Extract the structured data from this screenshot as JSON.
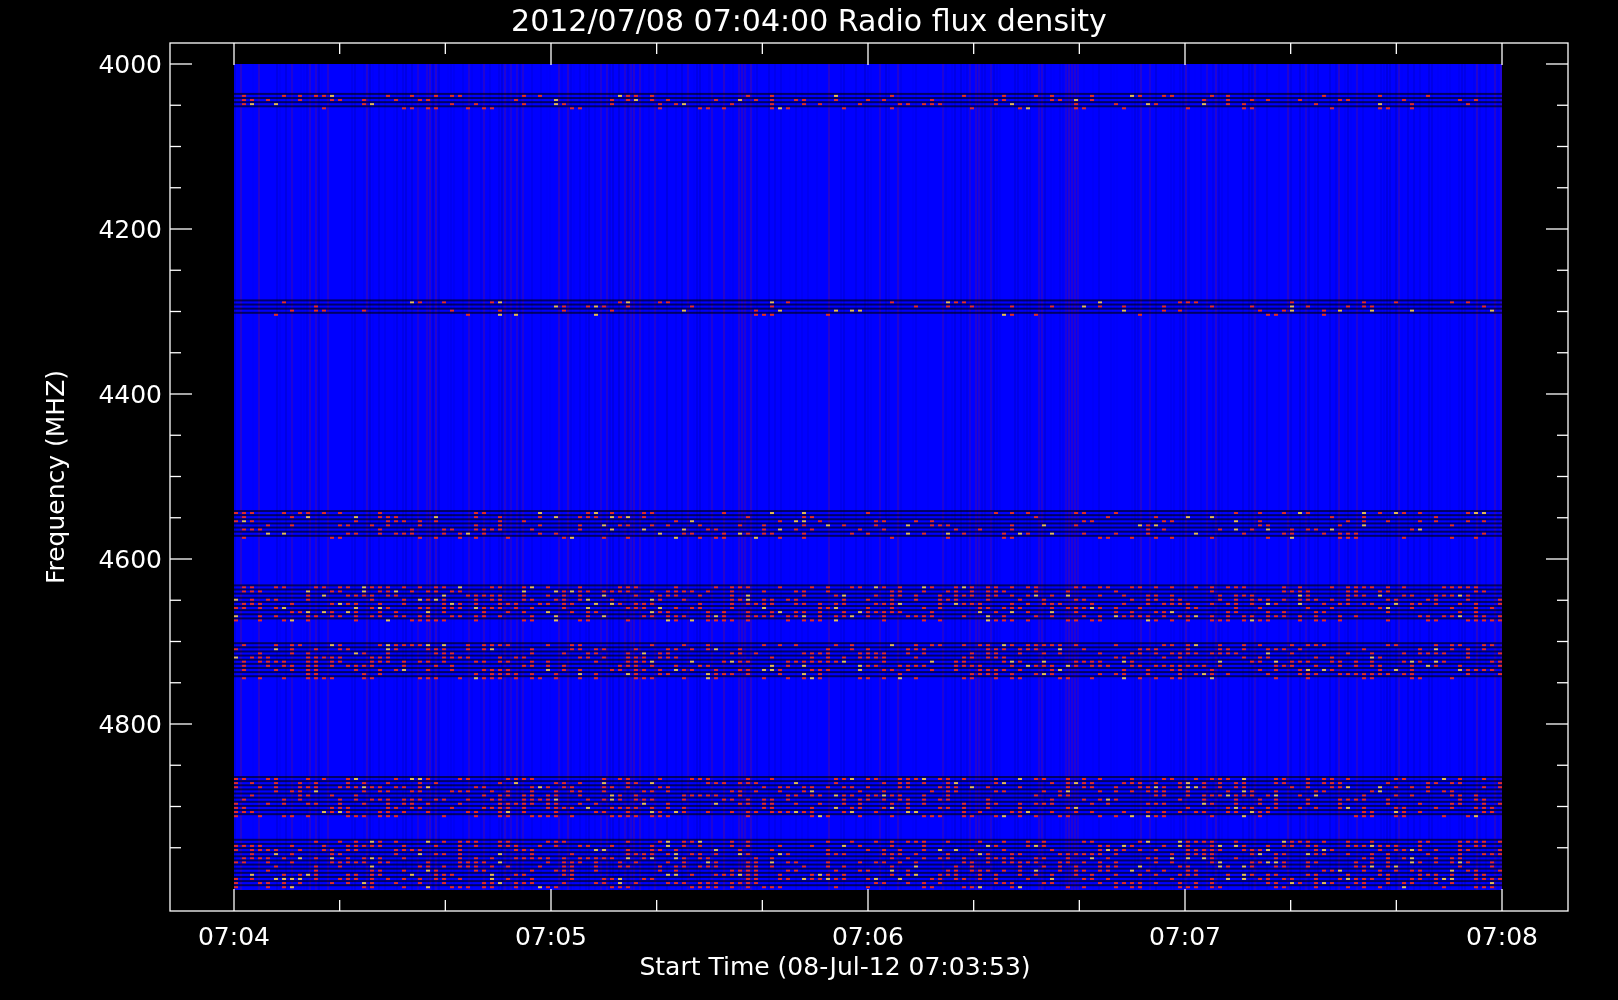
{
  "title": "2012/07/08 07:04:00 Radio flux density",
  "plot": {
    "y_axis": {
      "title": "Frequency (MHZ)",
      "tick_labels": [
        "4000",
        "4200",
        "4400",
        "4600",
        "4800"
      ]
    },
    "x_axis": {
      "title": "Start Time (08-Jul-12 07:03:53)",
      "tick_labels": [
        "07:04",
        "07:05",
        "07:06",
        "07:07",
        "07:08"
      ]
    }
  }
}
